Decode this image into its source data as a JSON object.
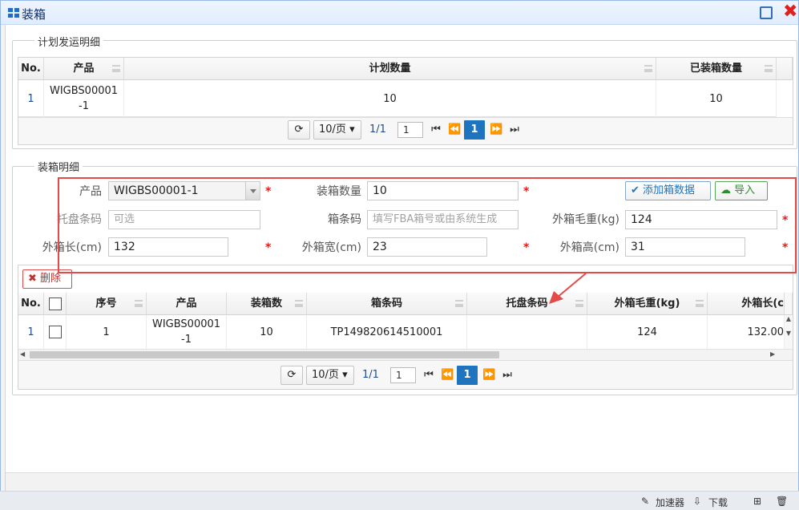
{
  "window": {
    "title": "装箱"
  },
  "plan_section": {
    "legend": "计划发运明细",
    "columns": [
      "No.",
      "产品",
      "计划数量",
      "已装箱数量"
    ],
    "rows": [
      {
        "no": "1",
        "product_line1": "WIGBS00001",
        "product_line2": "-1",
        "plan_qty": "10",
        "packed_qty": "10"
      }
    ],
    "pager": {
      "page_size": "10/页",
      "page_info": "1/1",
      "page_input": "1",
      "current_page": "1"
    }
  },
  "box_section": {
    "legend": "装箱明细",
    "form": {
      "product_label": "产品",
      "product_value": "WIGBS00001-1",
      "qty_label": "装箱数量",
      "qty_value": "10",
      "pallet_label": "托盘条码",
      "pallet_placeholder": "可选",
      "barcode_label": "箱条码",
      "barcode_placeholder": "填写FBA箱号或由系统生成",
      "weight_label": "外箱毛重(kg)",
      "weight_value": "124",
      "length_label": "外箱长(cm)",
      "length_value": "132",
      "width_label": "外箱宽(cm)",
      "width_value": "23",
      "height_label": "外箱高(cm)",
      "height_value": "31",
      "required_mark": "*",
      "add_button": "添加箱数据",
      "import_button": "导入",
      "delete_button": "删除"
    },
    "columns": [
      "No.",
      "序号",
      "产品",
      "装箱数",
      "箱条码",
      "托盘条码",
      "外箱毛重(kg)",
      "外箱长(c"
    ],
    "rows": [
      {
        "no": "1",
        "seq": "1",
        "product_line1": "WIGBS00001",
        "product_line2": "-1",
        "box_qty": "10",
        "barcode": "TP149820614510001",
        "pallet": "",
        "weight": "124",
        "length": "132.00"
      }
    ],
    "pager": {
      "page_size": "10/页",
      "page_info": "1/1",
      "page_input": "1",
      "current_page": "1"
    }
  },
  "statusbar": {
    "accelerator": "加速器",
    "download": "下载"
  },
  "colors": {
    "accent": "#1e74be",
    "required": "#e0201b",
    "highlight": "#e34a4a"
  }
}
